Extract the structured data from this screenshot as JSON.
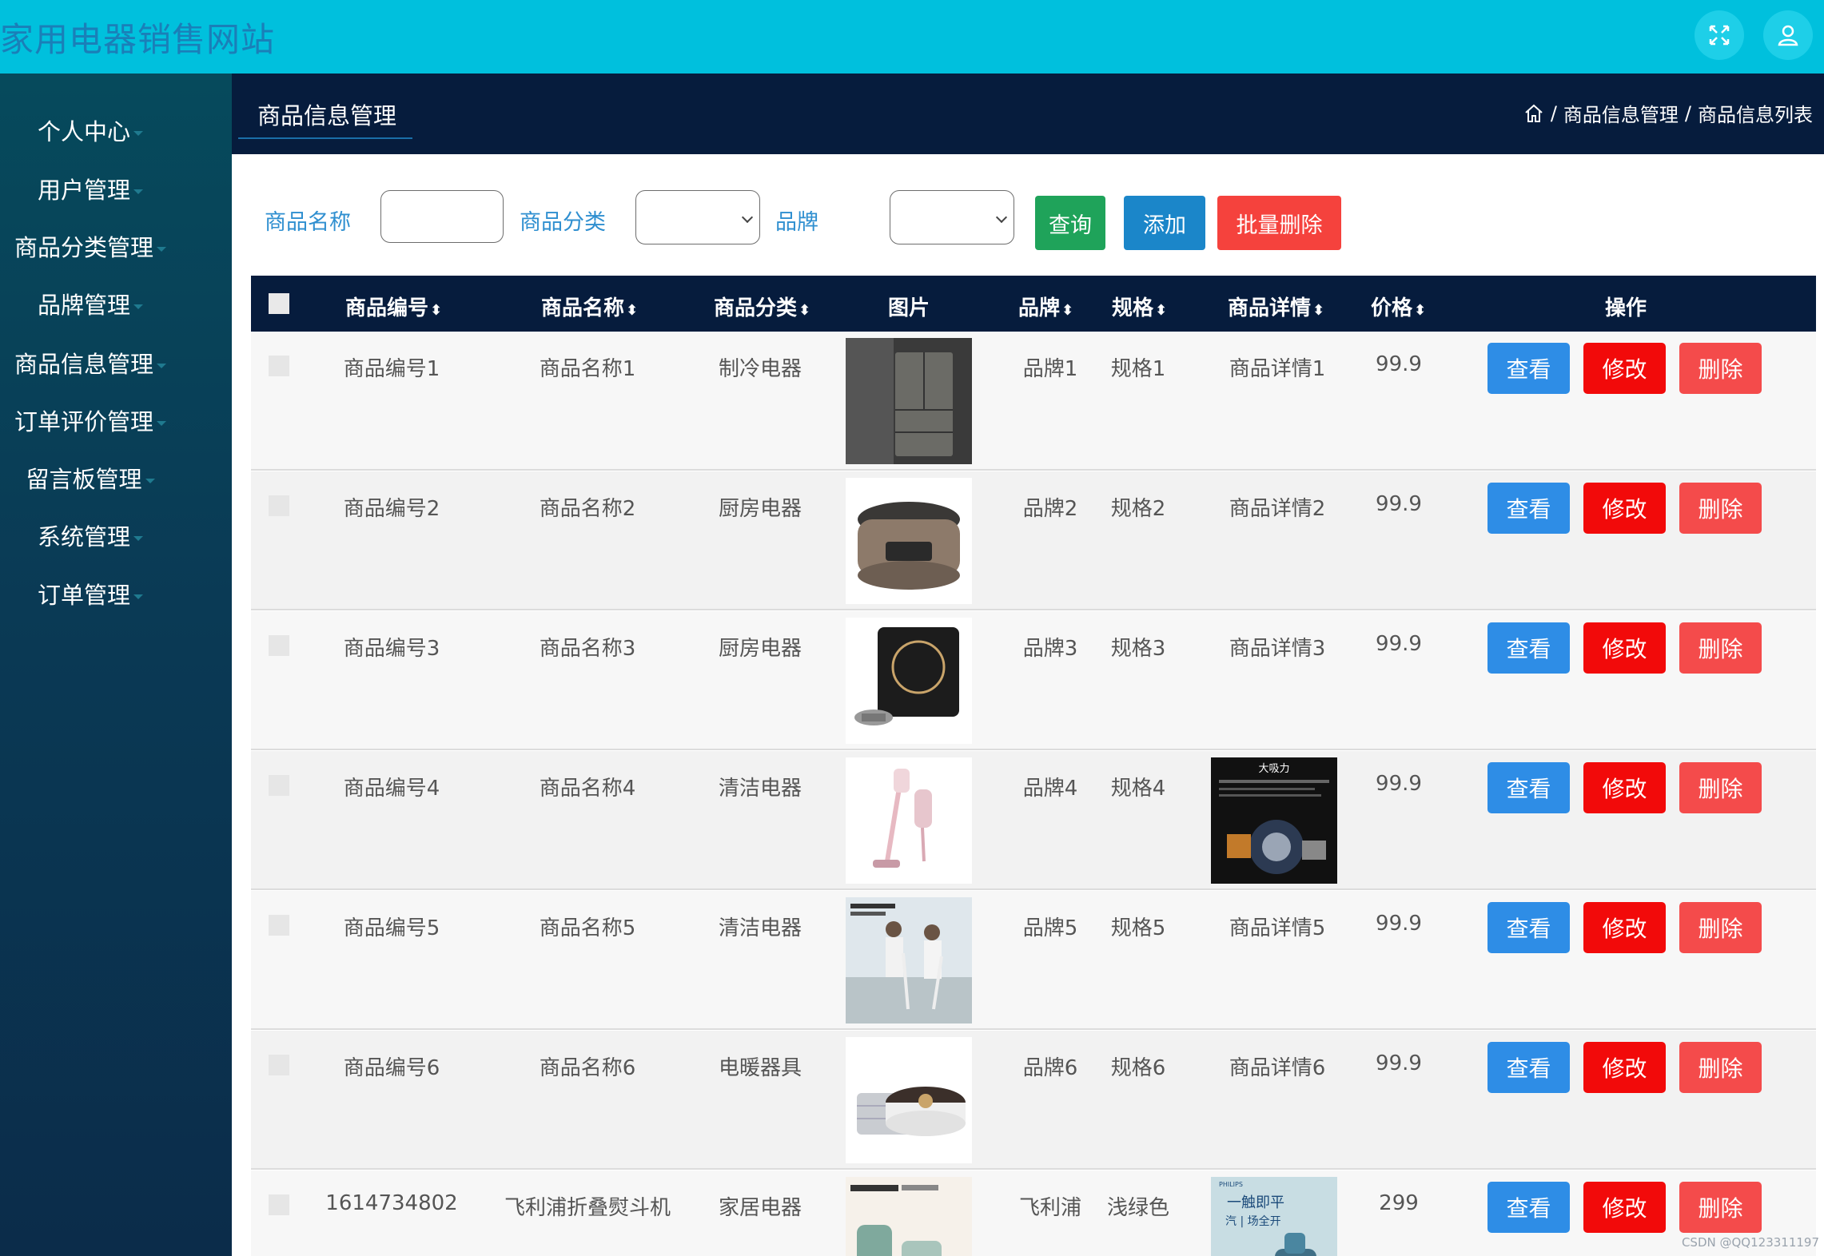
{
  "app": {
    "title": "家用电器销售网站"
  },
  "topbar": {
    "fullscreen_icon": "expand-icon",
    "user_icon": "user-icon"
  },
  "sidebar": {
    "items": [
      {
        "label": "个人中心"
      },
      {
        "label": "用户管理"
      },
      {
        "label": "商品分类管理"
      },
      {
        "label": "品牌管理"
      },
      {
        "label": "商品信息管理"
      },
      {
        "label": "订单评价管理"
      },
      {
        "label": "留言板管理"
      },
      {
        "label": "系统管理"
      },
      {
        "label": "订单管理"
      }
    ]
  },
  "header": {
    "tab_title": "商品信息管理",
    "breadcrumb": {
      "home_icon": "home-icon",
      "sep": "/",
      "level1": "商品信息管理",
      "level2": "商品信息列表"
    }
  },
  "filters": {
    "name_label": "商品名称",
    "name_value": "",
    "category_label": "商品分类",
    "category_value": "",
    "brand_label": "品牌",
    "brand_value": "",
    "query_button": "查询",
    "add_button": "添加",
    "batch_delete_button": "批量删除"
  },
  "colors": {
    "topbar": "#00c0dd",
    "header_bg": "#061c3d",
    "query": "#1fa35a",
    "add": "#1b86c9",
    "batch_delete": "#f5423d",
    "view": "#2e8de6",
    "edit": "#f20a0a",
    "delete": "#f44b4b"
  },
  "table": {
    "columns": [
      {
        "label": "商品编号",
        "sortable": true
      },
      {
        "label": "商品名称",
        "sortable": true
      },
      {
        "label": "商品分类",
        "sortable": true
      },
      {
        "label": "图片",
        "sortable": false
      },
      {
        "label": "品牌",
        "sortable": true
      },
      {
        "label": "规格",
        "sortable": true
      },
      {
        "label": "商品详情",
        "sortable": true
      },
      {
        "label": "价格",
        "sortable": true
      },
      {
        "label": "操作",
        "sortable": false
      }
    ],
    "sort_glyph": "⬍",
    "actions": {
      "view": "查看",
      "edit": "修改",
      "delete": "删除"
    },
    "rows": [
      {
        "id": "商品编号1",
        "name": "商品名称1",
        "category": "制冷电器",
        "image": "refrigerator",
        "brand": "品牌1",
        "spec": "规格1",
        "detail": "商品详情1",
        "detail_is_image": false,
        "price": "99.9"
      },
      {
        "id": "商品编号2",
        "name": "商品名称2",
        "category": "厨房电器",
        "image": "rice-cooker",
        "brand": "品牌2",
        "spec": "规格2",
        "detail": "商品详情2",
        "detail_is_image": false,
        "price": "99.9"
      },
      {
        "id": "商品编号3",
        "name": "商品名称3",
        "category": "厨房电器",
        "image": "induction-cooker",
        "brand": "品牌3",
        "spec": "规格3",
        "detail": "商品详情3",
        "detail_is_image": false,
        "price": "99.9"
      },
      {
        "id": "商品编号4",
        "name": "商品名称4",
        "category": "清洁电器",
        "image": "stick-vacuum",
        "brand": "品牌4",
        "spec": "规格4",
        "detail": "大吸力",
        "detail_is_image": true,
        "price": "99.9"
      },
      {
        "id": "商品编号5",
        "name": "商品名称5",
        "category": "清洁电器",
        "image": "vacuum-lifestyle",
        "brand": "品牌5",
        "spec": "规格5",
        "detail": "商品详情5",
        "detail_is_image": false,
        "price": "99.9"
      },
      {
        "id": "商品编号6",
        "name": "商品名称6",
        "category": "电暖器具",
        "image": "heater",
        "brand": "品牌6",
        "spec": "规格6",
        "detail": "商品详情6",
        "detail_is_image": false,
        "price": "99.9"
      },
      {
        "id": "1614734802",
        "name": "飞利浦折叠熨斗机",
        "category": "家居电器",
        "image": "iron",
        "brand": "飞利浦",
        "spec": "浅绿色",
        "detail": "汽 | 场全开",
        "detail_is_image": true,
        "price": "299"
      }
    ]
  },
  "watermark": "CSDN @QQ123311197"
}
